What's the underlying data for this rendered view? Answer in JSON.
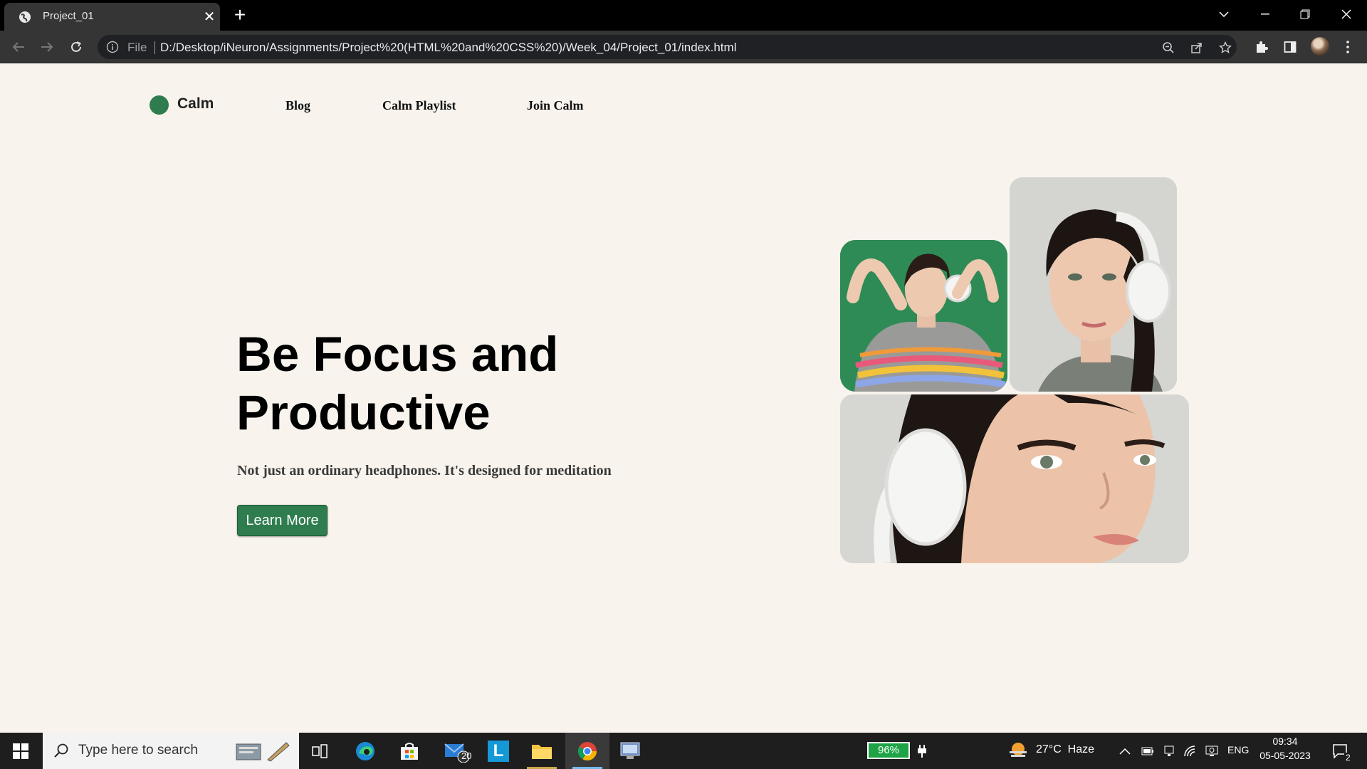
{
  "browser": {
    "tab_title": "Project_01",
    "omnibox_scheme": "File",
    "url": "D:/Desktop/iNeuron/Assignments/Project%20(HTML%20and%20CSS%20)/Week_04/Project_01/index.html"
  },
  "site": {
    "logo_text": "Calm",
    "nav": [
      "Blog",
      "Calm Playlist",
      "Join Calm"
    ],
    "hero_title": "Be Focus and Productive",
    "hero_subtitle": "Not just an ordinary headphones. It's designed for meditation",
    "cta_label": "Learn More",
    "brand_color": "#2f7d4f"
  },
  "taskbar": {
    "search_placeholder": "Type here to search",
    "mail_badge": "20",
    "battery": "96%",
    "weather": "27°C  Haze",
    "language": "ENG",
    "time": "09:34",
    "date": "05-05-2023",
    "notifications": "2"
  }
}
